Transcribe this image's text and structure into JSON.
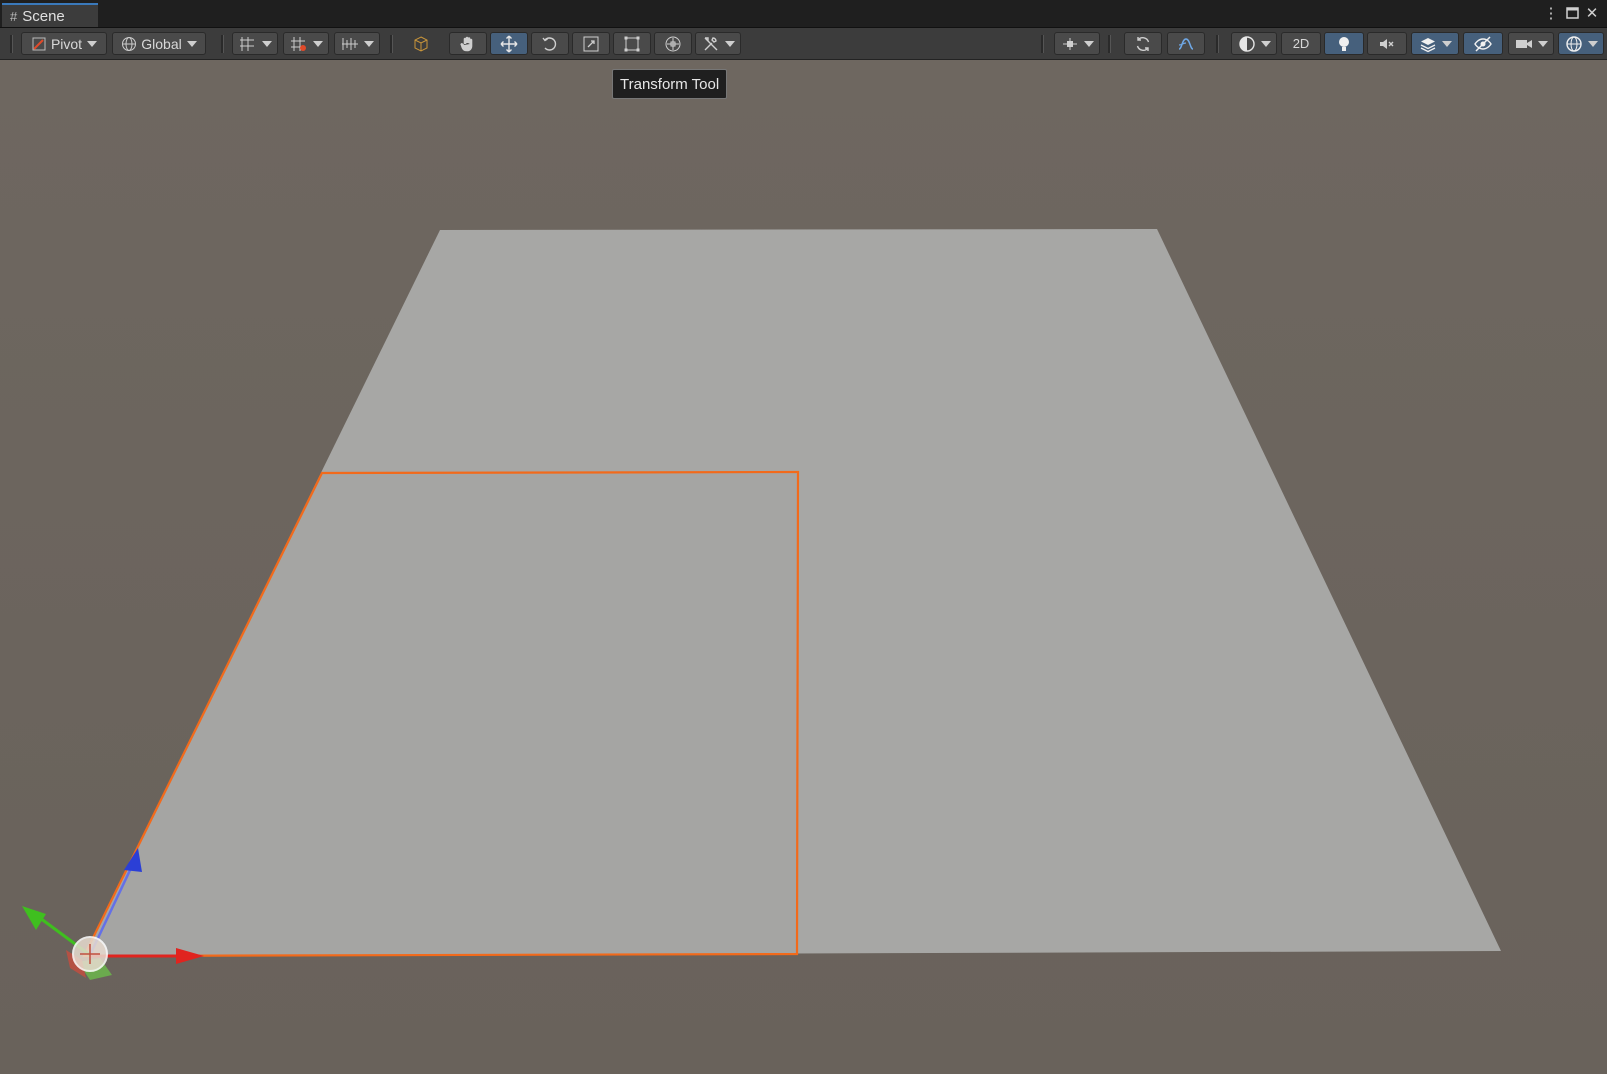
{
  "window": {
    "tab_label": "Scene",
    "tab_icon": "hash-icon"
  },
  "toolbar": {
    "pivot_label": "Pivot",
    "global_label": "Global",
    "mode_2d_label": "2D",
    "active_tool": "move-tool"
  },
  "tooltip": {
    "text": "Transform Tool"
  },
  "scene": {
    "background_color": "#6b645d",
    "plane_color": "#a7a7a5",
    "selection_outline_color": "#f26a1b",
    "gizmo": {
      "x_axis_color": "#e0241f",
      "y_axis_color": "#3fbf1f",
      "z_axis_color": "#2b3fd6"
    }
  }
}
